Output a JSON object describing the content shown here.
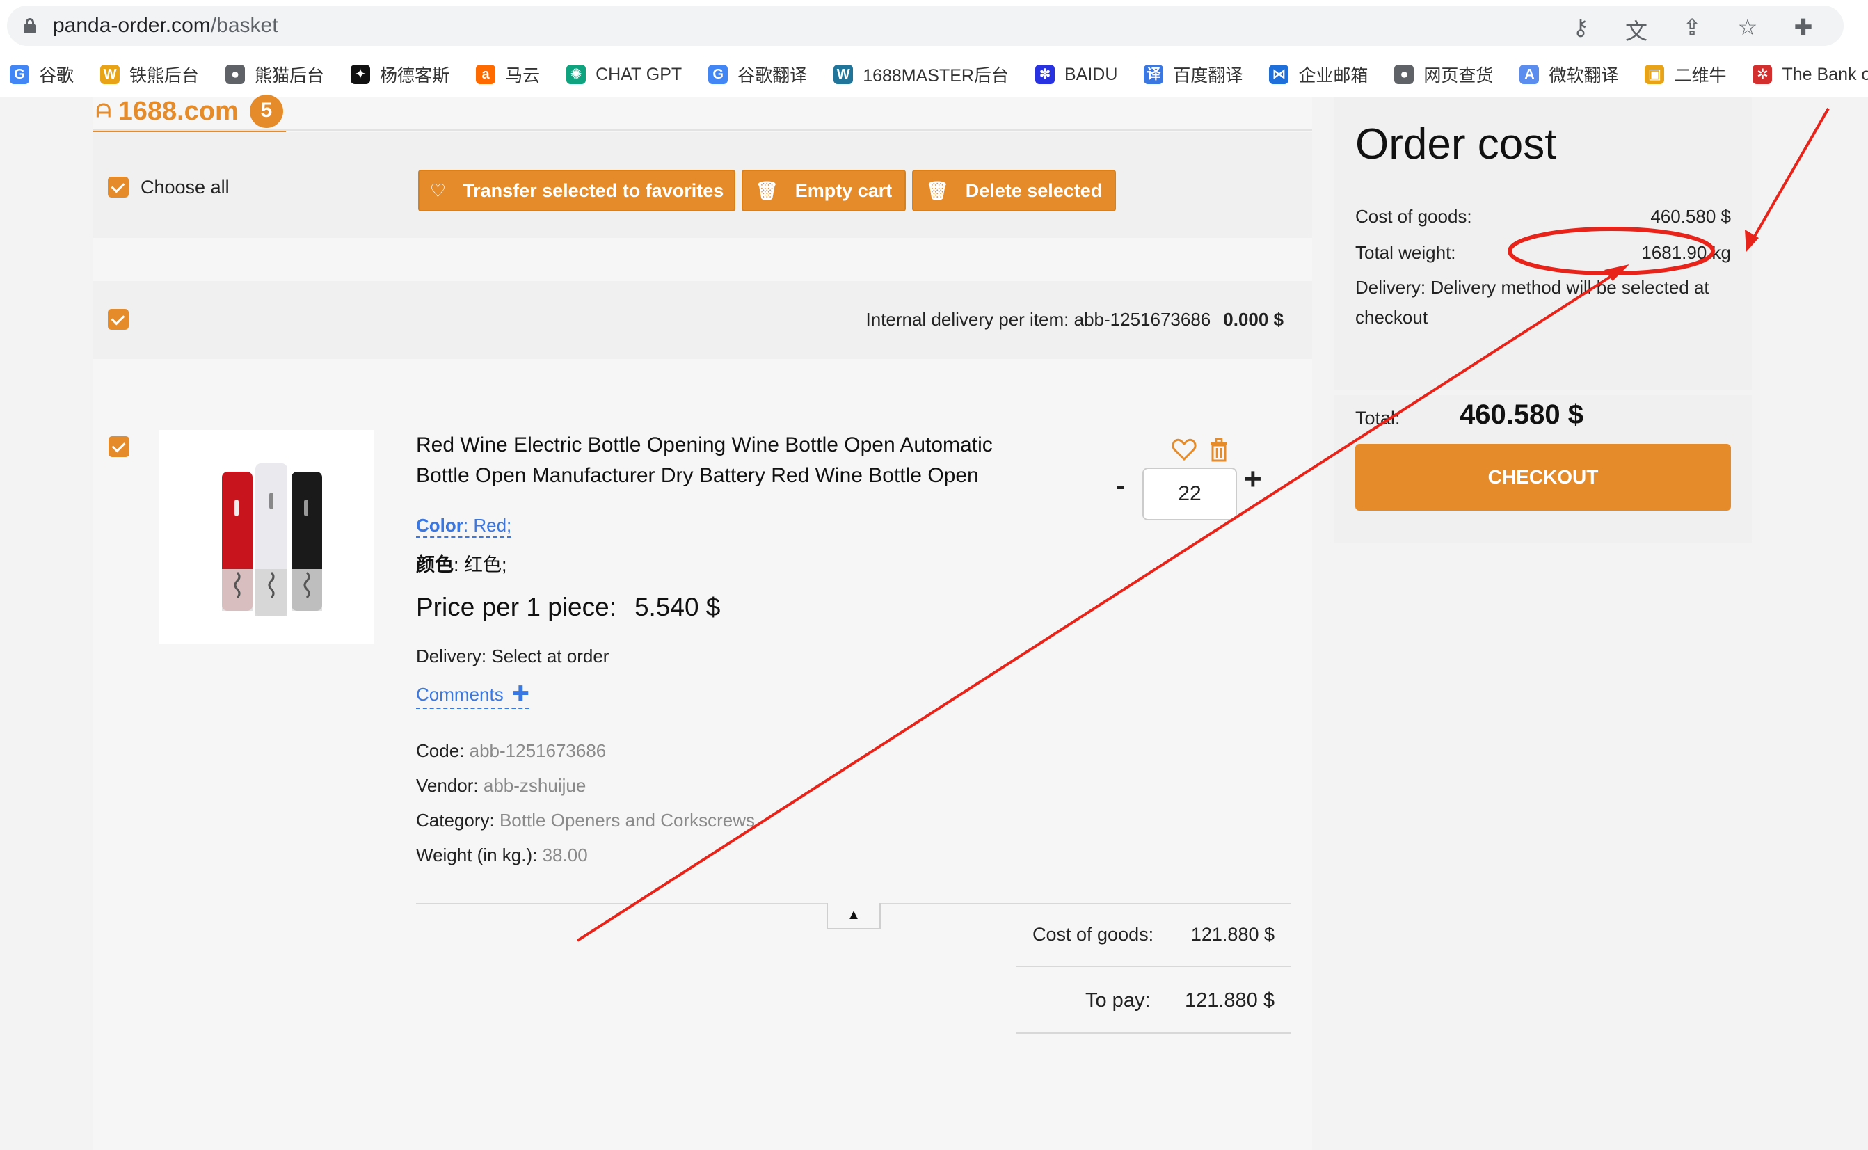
{
  "browser": {
    "url_domain": "panda-order.com",
    "url_path": "/basket",
    "bookmarks": [
      {
        "label": "谷歌",
        "icon": "google-icon",
        "color": "#4285f4",
        "glyph": "G"
      },
      {
        "label": "铁熊后台",
        "icon": "w-logo-icon",
        "color": "#e8a317",
        "glyph": "W"
      },
      {
        "label": "熊猫后台",
        "icon": "globe-icon",
        "color": "#5f6368",
        "glyph": "●"
      },
      {
        "label": "杨德客斯",
        "icon": "compass-icon",
        "color": "#111111",
        "glyph": "✦"
      },
      {
        "label": "马云",
        "icon": "alibaba-icon",
        "color": "#ff6a00",
        "glyph": "a"
      },
      {
        "label": "CHAT GPT",
        "icon": "chatgpt-icon",
        "color": "#10a37f",
        "glyph": "✺"
      },
      {
        "label": "谷歌翻译",
        "icon": "translate-icon",
        "color": "#4285f4",
        "glyph": "G"
      },
      {
        "label": "1688MASTER后台",
        "icon": "wordpress-icon",
        "color": "#21759b",
        "glyph": "W"
      },
      {
        "label": "BAIDU",
        "icon": "paw-icon",
        "color": "#2932e1",
        "glyph": "✽"
      },
      {
        "label": "百度翻译",
        "icon": "translate-icon",
        "color": "#3b77e0",
        "glyph": "译"
      },
      {
        "label": "企业邮箱",
        "icon": "mail-icon",
        "color": "#1e6fd9",
        "glyph": "⋈"
      },
      {
        "label": "网页查货",
        "icon": "globe-icon",
        "color": "#5f6368",
        "glyph": "●"
      },
      {
        "label": "微软翻译",
        "icon": "translate-icon",
        "color": "#5b8def",
        "glyph": "A"
      },
      {
        "label": "二维牛",
        "icon": "qrcode-icon",
        "color": "#e8a317",
        "glyph": "▣"
      },
      {
        "label": "The Bank of Eas",
        "icon": "bank-icon",
        "color": "#d32f2f",
        "glyph": "✲"
      }
    ]
  },
  "store": {
    "name": "1688.com",
    "count": "5"
  },
  "toolbar": {
    "choose_all": "Choose all",
    "transfer": "Transfer selected to favorites",
    "empty": "Empty cart",
    "delete": "Delete selected"
  },
  "delivery": {
    "label": "Internal delivery per item: abb-1251673686",
    "value": "0.000 $"
  },
  "product": {
    "title": "Red Wine Electric Bottle Opening Wine Bottle Open Automatic Bottle Open Manufacturer Dry Battery Red Wine Bottle Open",
    "color_label": "Color",
    "color_value": ": Red;",
    "cn_label": "颜色",
    "cn_value": ": 红色;",
    "price_label": "Price per 1 piece:",
    "price_value": "5.540 $",
    "delivery_line": "Delivery: Select at order",
    "comments": "Comments",
    "code_label": "Code:",
    "code_value": "abb-1251673686",
    "vendor_label": "Vendor:",
    "vendor_value": "abb-zshuijue",
    "category_label": "Category:",
    "category_value": "Bottle Openers and Corkscrews",
    "weight_label": "Weight (in kg.):",
    "weight_value": "38.00",
    "quantity": "22",
    "minus": "-",
    "plus": "+",
    "cost_label": "Cost of goods:",
    "cost_value": "121.880 $",
    "pay_label": "To pay:",
    "pay_value": "121.880 $"
  },
  "order": {
    "title": "Order cost",
    "cost_label": "Cost of goods:",
    "cost_value": "460.580 $",
    "weight_label": "Total weight:",
    "weight_value": "1681.90 kg",
    "delivery_text": "Delivery:  Delivery method will be selected at checkout",
    "total_label": "Total:",
    "total_value": "460.580 $",
    "checkout": "CHECKOUT"
  },
  "colors": {
    "accent": "#e58b2a",
    "link": "#3b77e0",
    "annotation": "#e8231a"
  }
}
